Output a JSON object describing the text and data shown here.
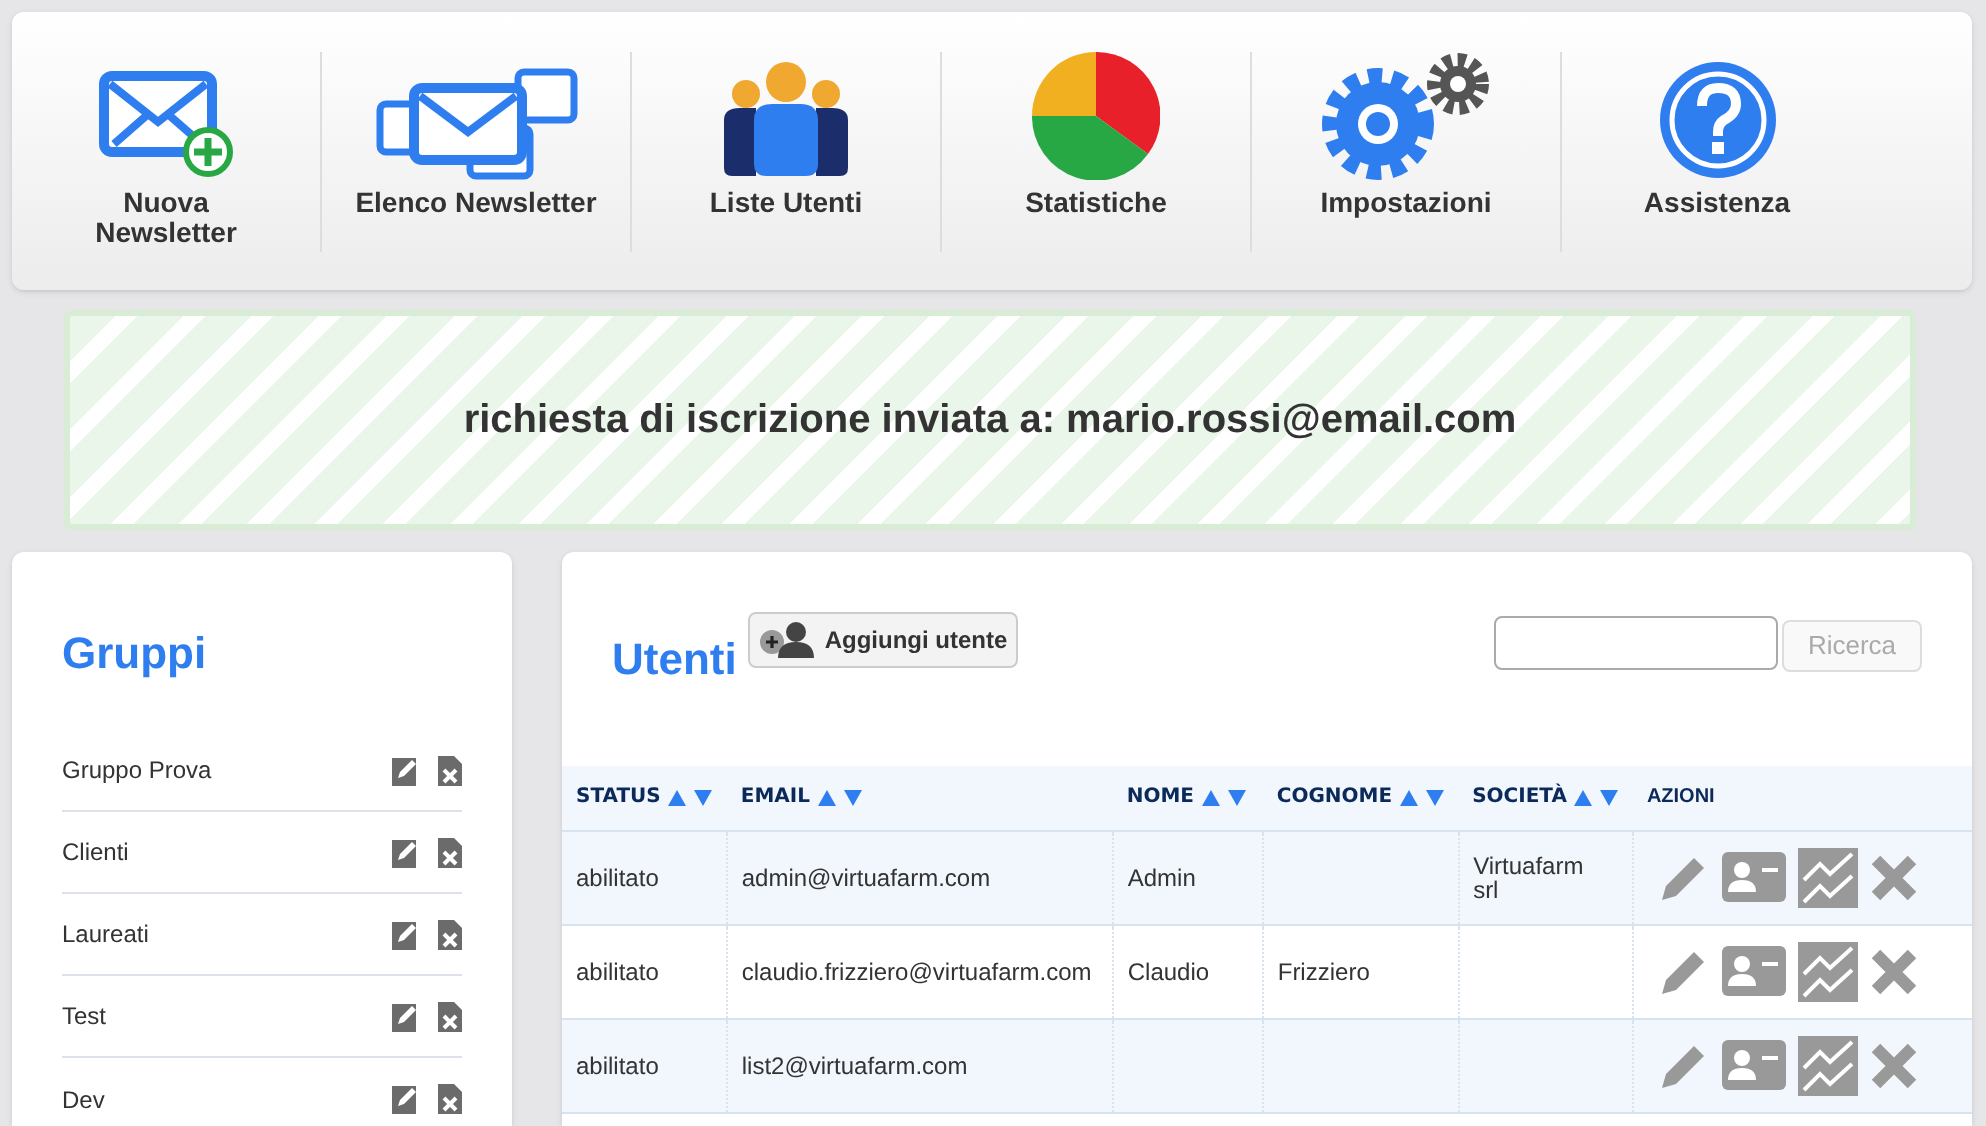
{
  "toolbar": [
    {
      "label": "Nuova Newsletter"
    },
    {
      "label": "Elenco Newsletter"
    },
    {
      "label": "Liste Utenti"
    },
    {
      "label": "Statistiche"
    },
    {
      "label": "Impostazioni"
    },
    {
      "label": "Assistenza"
    }
  ],
  "notice": "richiesta di iscrizione inviata a: mario.rossi@email.com",
  "groups": {
    "title": "Gruppi",
    "items": [
      "Gruppo Prova",
      "Clienti",
      "Laureati",
      "Test",
      "Dev"
    ]
  },
  "users": {
    "title": "Utenti",
    "add_button": "Aggiungi utente",
    "search_button": "Ricerca",
    "columns": [
      {
        "label": "STATUS",
        "sortable": true
      },
      {
        "label": "EMAIL",
        "sortable": true
      },
      {
        "label": "NOME",
        "sortable": true
      },
      {
        "label": "COGNOME",
        "sortable": true
      },
      {
        "label": "SOCIETÀ",
        "sortable": true
      },
      {
        "label": "AZIONI",
        "sortable": false
      }
    ],
    "rows": [
      [
        "abilitato",
        "admin@virtuafarm.com",
        "Admin",
        "",
        "Virtuafarm srl"
      ],
      [
        "abilitato",
        "claudio.frizziero@virtuafarm.com",
        "Claudio",
        "Frizziero",
        ""
      ],
      [
        "abilitato",
        "list2@virtuafarm.com",
        "",
        "",
        ""
      ]
    ]
  }
}
